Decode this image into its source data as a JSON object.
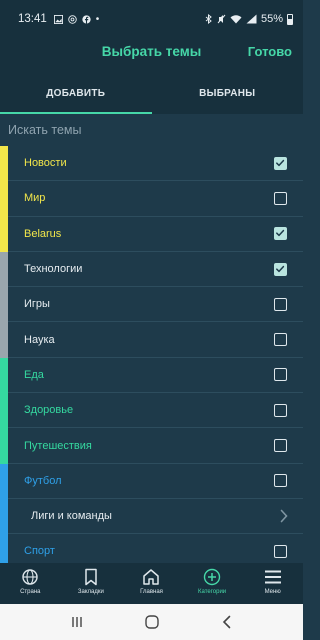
{
  "status_bar": {
    "time": "13:41",
    "battery": "55%"
  },
  "header": {
    "title": "Выбрать темы",
    "done_label": "Готово"
  },
  "tabs": [
    {
      "label": "ДОБАВИТЬ",
      "active": true
    },
    {
      "label": "ВЫБРАНЫ",
      "active": false
    }
  ],
  "search": {
    "placeholder": "Искать темы"
  },
  "colors": {
    "accent": "#46d7a8",
    "yellow": "#f2e64a",
    "gray": "#9aa6ad",
    "green": "#35d9a0",
    "blue": "#2fa0e8"
  },
  "topics": [
    {
      "label": "Новости",
      "color": "#f2e64a",
      "checked": true
    },
    {
      "label": "Мир",
      "color": "#f2e64a",
      "checked": false
    },
    {
      "label": "Belarus",
      "color": "#f2e64a",
      "checked": true
    },
    {
      "label": "Технологии",
      "color": "#9aa6ad",
      "checked": true
    },
    {
      "label": "Игры",
      "color": "#9aa6ad",
      "checked": false
    },
    {
      "label": "Наука",
      "color": "#9aa6ad",
      "checked": false
    },
    {
      "label": "Еда",
      "color": "#35d9a0",
      "checked": false
    },
    {
      "label": "Здоровье",
      "color": "#35d9a0",
      "checked": false
    },
    {
      "label": "Путешествия",
      "color": "#35d9a0",
      "checked": false
    },
    {
      "label": "Футбол",
      "color": "#2fa0e8",
      "checked": false
    },
    {
      "label": "Лиги и команды",
      "sub": true
    },
    {
      "label": "Спорт",
      "color": "#2fa0e8",
      "checked": false
    }
  ],
  "bottom_nav": [
    {
      "label": "Страна",
      "icon": "globe-icon"
    },
    {
      "label": "Закладки",
      "icon": "bookmark-icon"
    },
    {
      "label": "Главная",
      "icon": "home-icon"
    },
    {
      "label": "Категории",
      "icon": "plus-circle-icon",
      "active": true
    },
    {
      "label": "Меню",
      "icon": "menu-icon"
    }
  ]
}
